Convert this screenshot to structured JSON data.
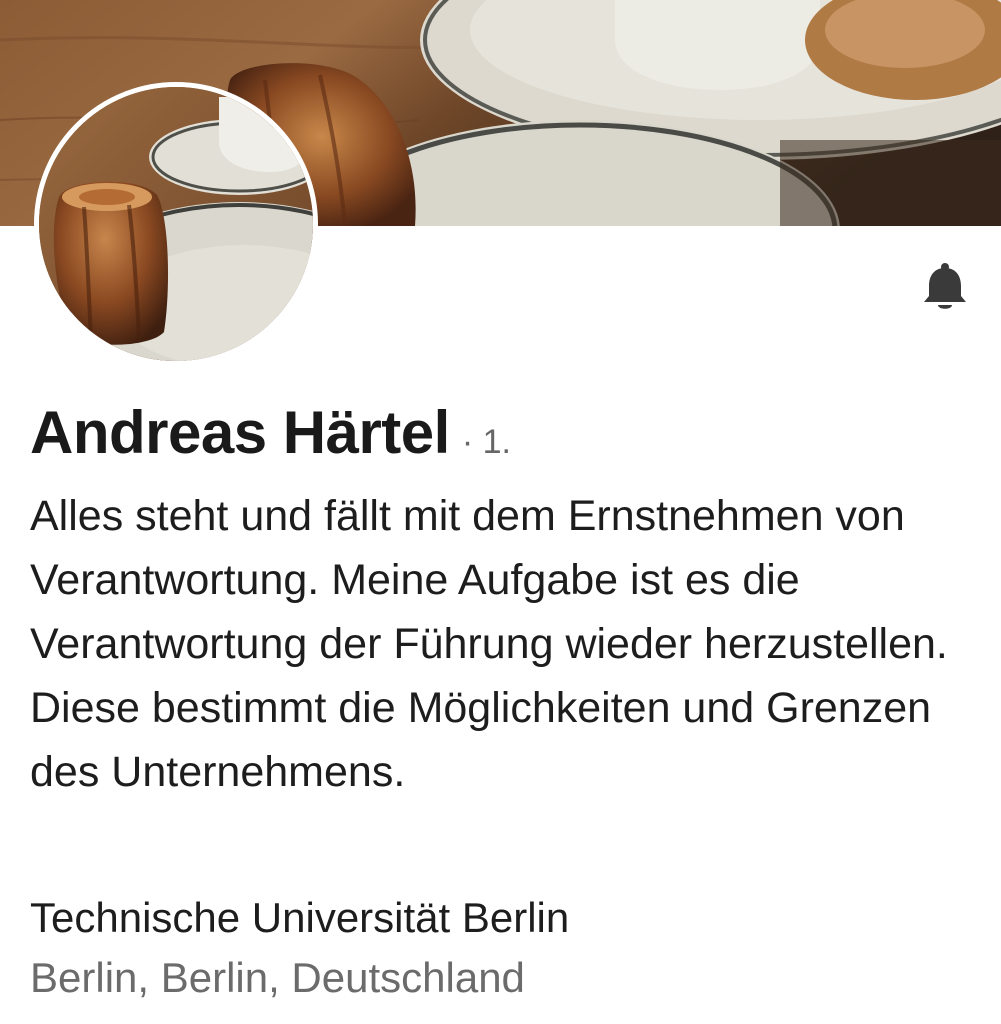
{
  "profile": {
    "name": "Andreas Härtel",
    "connection_degree": "· 1.",
    "headline": "Alles steht und fällt mit dem Ernstnehmen von Verantwortung. Meine Aufgabe ist es die Verantwortung der Führung wieder herzustellen. Diese bestimmt die Möglichkeiten und Grenzen des Unternehmens.",
    "education": "Technische Universität Berlin",
    "location": "Berlin, Berlin, Deutschland"
  },
  "cover": {
    "icon": "cover-photo"
  },
  "avatar": {
    "icon": "profile-photo"
  },
  "actions": {
    "notification_icon": "bell-icon"
  },
  "colors": {
    "text_primary": "#1d1d1d",
    "text_secondary": "#6b6b6b",
    "background": "#ffffff",
    "bell": "#3a3a3a"
  }
}
